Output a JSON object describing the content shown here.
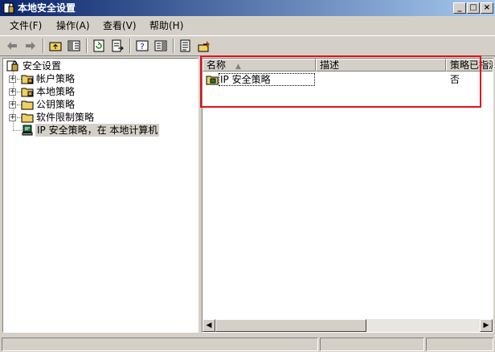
{
  "window": {
    "title": "本地安全设置",
    "controls": {
      "minimize": "_",
      "maximize": "□",
      "close": "×"
    }
  },
  "menu": [
    {
      "label": "文件(F)"
    },
    {
      "label": "操作(A)"
    },
    {
      "label": "查看(V)"
    },
    {
      "label": "帮助(H)"
    }
  ],
  "toolbar": {
    "icons": [
      "back-arrow-icon",
      "forward-arrow-icon",
      "up-folder-icon",
      "show-hide-tree-icon",
      "refresh-icon",
      "export-list-icon",
      "help-icon",
      "action-pane-icon",
      "properties-icon",
      "assign-icon"
    ]
  },
  "tree": {
    "root": "安全设置",
    "expander_plus": "+",
    "items": [
      {
        "label": "帐户策略"
      },
      {
        "label": "本地策略"
      },
      {
        "label": "公钥策略"
      },
      {
        "label": "软件限制策略"
      },
      {
        "label": "IP 安全策略，在 本地计算机"
      }
    ]
  },
  "list": {
    "columns": [
      {
        "label": "名称",
        "sort": "▲"
      },
      {
        "label": "描述"
      },
      {
        "label": "策略已指派"
      }
    ],
    "rows": [
      {
        "name": "IP 安全策略",
        "description": "",
        "assigned": "否"
      }
    ]
  },
  "scrollbar": {
    "left": "◀",
    "right": "▶"
  },
  "colors": {
    "title_start": "#0a246a",
    "title_end": "#a6caf0",
    "highlight": "#e0101c",
    "face": "#d4d0c8"
  }
}
